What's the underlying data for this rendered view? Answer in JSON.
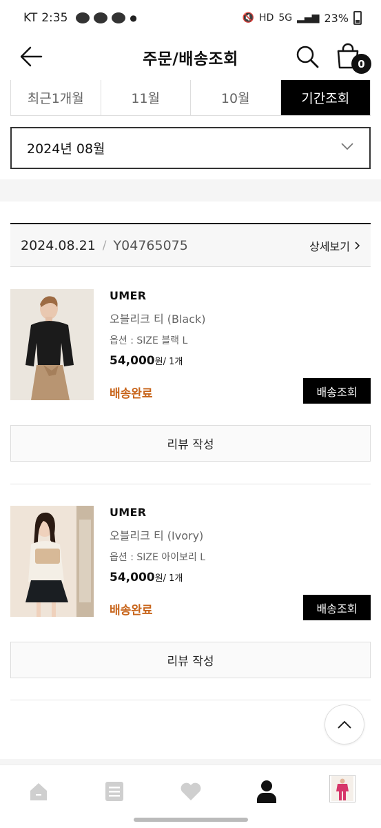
{
  "status_bar": {
    "carrier": "KT",
    "time": "2:35",
    "talk": "TALK",
    "hd": "HD",
    "net": "5G",
    "battery": "23%"
  },
  "header": {
    "title": "주문/배송조회",
    "cart_count": "0"
  },
  "period_tabs": [
    {
      "label": "최근1개월"
    },
    {
      "label": "11월"
    },
    {
      "label": "10월"
    },
    {
      "label": "기간조회"
    }
  ],
  "month_select": {
    "value": "2024년 08월"
  },
  "order": {
    "date": "2024.08.21",
    "separator": "/",
    "number": "Y04765075",
    "detail_label": "상세보기"
  },
  "items": [
    {
      "brand": "UMER",
      "name": "오블리크 티 (Black)",
      "option": "옵션 : SIZE 블랙 L",
      "price": "54,000",
      "price_suffix": "원/ 1개",
      "status": "배송완료",
      "track_label": "배송조회",
      "review_label": "리뷰 작성"
    },
    {
      "brand": "UMER",
      "name": "오블리크 티 (Ivory)",
      "option": "옵션 : SIZE 아이보리 L",
      "price": "54,000",
      "price_suffix": "원/ 1개",
      "status": "배송완료",
      "track_label": "배송조회",
      "review_label": "리뷰 작성"
    }
  ],
  "colors": {
    "accent_status": "#c8651b",
    "selected_tab": "#000000",
    "icon_gray": "#cfcfcf"
  },
  "icons": [
    "back-arrow-icon",
    "search-icon",
    "shopping-bag-icon",
    "chevron-down-icon",
    "chevron-right-icon",
    "chevron-up-icon",
    "home-icon",
    "list-icon",
    "heart-icon",
    "person-icon"
  ]
}
